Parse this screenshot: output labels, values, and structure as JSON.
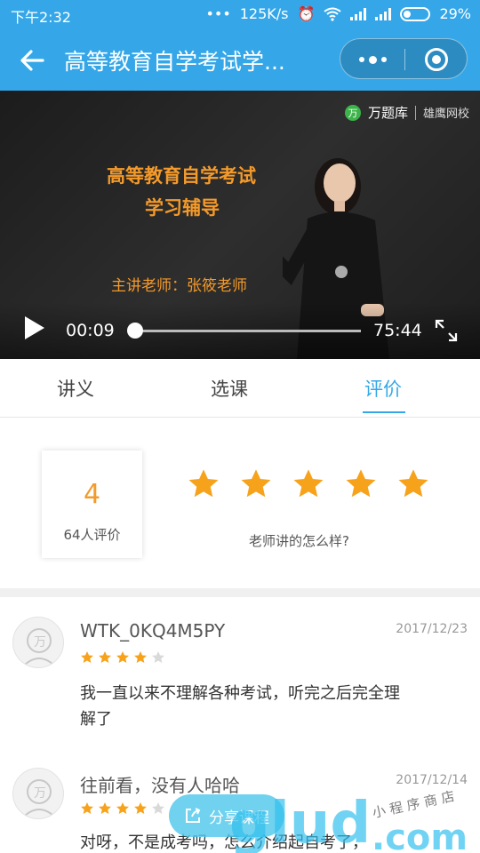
{
  "status_bar": {
    "time": "下午2:32",
    "network_speed": "125K/s",
    "battery": "29%",
    "icons": [
      "dots-icon",
      "alarm-icon",
      "wifi-icon",
      "signal-icon",
      "signal-icon",
      "battery-icon"
    ]
  },
  "nav": {
    "title": "高等教育自学考试学...",
    "back_icon": "back-arrow-icon",
    "more_icon": "more-dots-icon",
    "close_icon": "target-close-icon"
  },
  "video": {
    "brand_name": "万题库",
    "brand_mark": "万",
    "partner": "雄鹰网校",
    "course_title_line1": "高等教育自学考试",
    "course_title_line2": "学习辅导",
    "teacher": "主讲老师：张筱老师",
    "current_time": "00:09",
    "total_time": "75:44",
    "progress": 0
  },
  "tabs": [
    {
      "label": "讲义",
      "active": false
    },
    {
      "label": "选课",
      "active": false
    },
    {
      "label": "评价",
      "active": true
    }
  ],
  "rating": {
    "score": "4",
    "count_label": "64人评价",
    "prompt": "老师讲的怎么样?",
    "input_stars": 5
  },
  "reviews": [
    {
      "name": "WTK_0KQ4M5PY",
      "date": "2017/12/23",
      "stars": 4,
      "text": "我一直以来不理解各种考试，听完之后完全理解了"
    },
    {
      "name": "往前看，没有人哈哈",
      "date": "2017/12/14",
      "stars": 4,
      "text": "对呀，不是成考吗，怎么介绍起自考了，"
    }
  ],
  "share_button": {
    "label": "分享课程"
  },
  "colors": {
    "primary": "#35a7e8",
    "star": "#f7a21b",
    "star_empty": "#d9d9d9",
    "accent_text": "#f49a2a"
  }
}
